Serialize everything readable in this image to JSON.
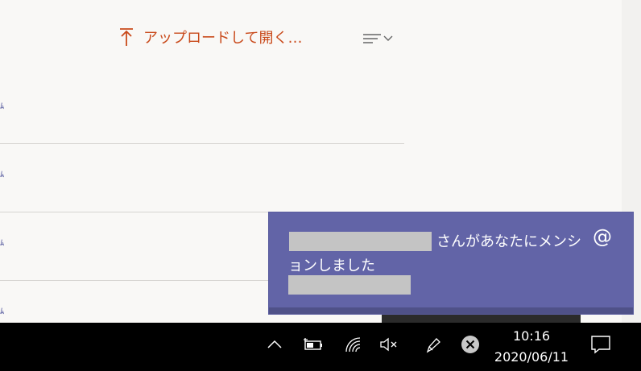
{
  "toolbar": {
    "upload_label": "アップロードして開く…"
  },
  "notification": {
    "message": "さんがあなたにメンションしました"
  },
  "taskbar": {
    "time": "10:16",
    "date": "2020/06/11"
  },
  "icons": {
    "upload": "upload-arrow-icon",
    "sort": "sort-menu-icon",
    "chevron": "chevron-up-icon",
    "battery": "battery-charging-icon",
    "wifi": "wifi-icon",
    "volume": "volume-muted-icon",
    "pen": "pen-icon",
    "close": "close-circle-icon",
    "action_center": "action-center-icon",
    "mention": "at-icon"
  },
  "colors": {
    "accent": "#c94a1b",
    "toast": "#6264a7",
    "taskbar": "#000000"
  }
}
